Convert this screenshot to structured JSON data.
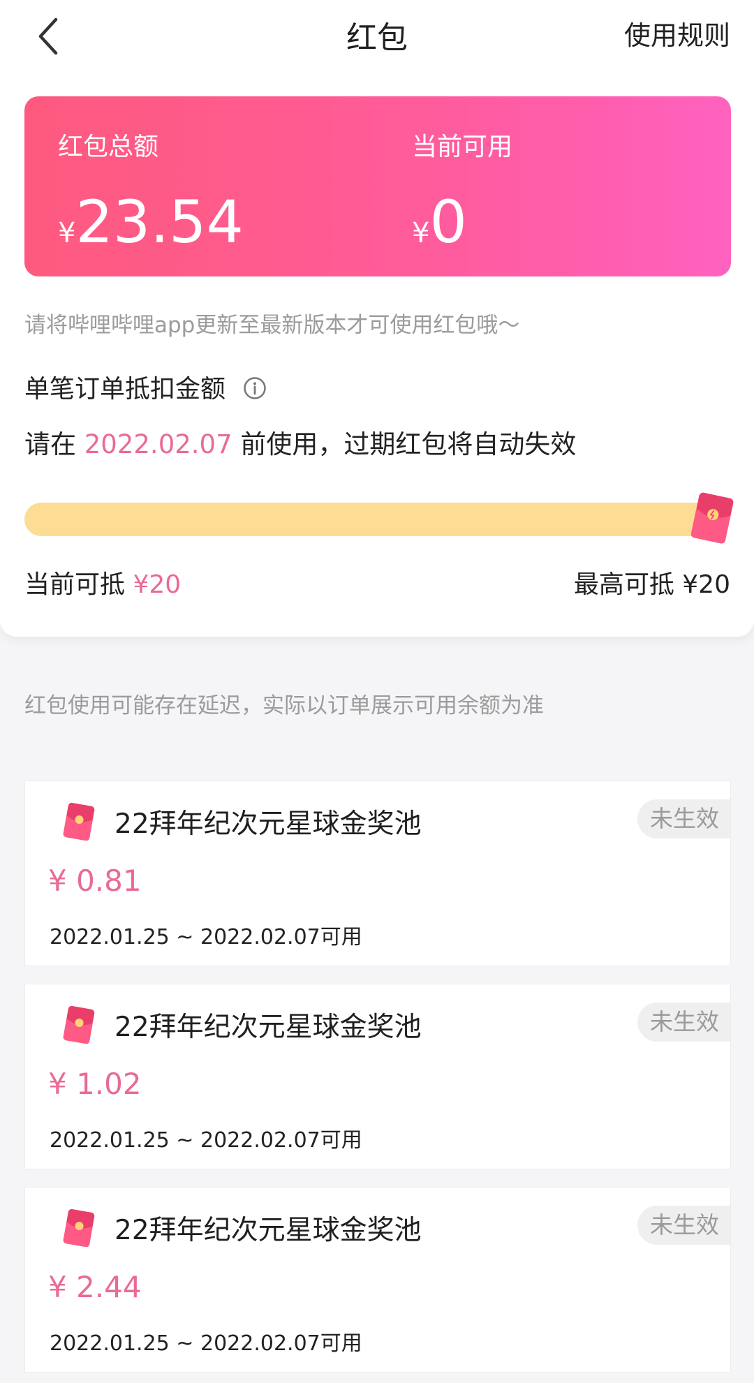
{
  "nav": {
    "title": "红包",
    "rules_label": "使用规则"
  },
  "summary": {
    "total_label": "红包总额",
    "total_currency": "¥",
    "total_value": "23.54",
    "available_label": "当前可用",
    "available_currency": "¥",
    "available_value": "0"
  },
  "notice": "请将哔哩哔哩app更新至最新版本才可使用红包哦～",
  "deduction": {
    "title": "单笔订单抵扣金额",
    "expire_prefix": "请在",
    "expire_date": "2022.02.07",
    "expire_suffix": "前使用，过期红包将自动失效",
    "progress_fraction": 1.0,
    "current_label": "当前可抵",
    "current_value": "¥20",
    "max_label": "最高可抵 ¥20"
  },
  "delay_notice": "红包使用可能存在延迟，实际以订单展示可用余额为准",
  "packets": [
    {
      "name": "22拜年纪次元星球金奖池",
      "status": "未生效",
      "amount": "¥ 0.81",
      "validity": "2022.01.25 ~ 2022.02.07可用"
    },
    {
      "name": "22拜年纪次元星球金奖池",
      "status": "未生效",
      "amount": "¥ 1.02",
      "validity": "2022.01.25 ~ 2022.02.07可用"
    },
    {
      "name": "22拜年纪次元星球金奖池",
      "status": "未生效",
      "amount": "¥ 2.44",
      "validity": "2022.01.25 ~ 2022.02.07可用"
    }
  ],
  "colors": {
    "accent": "#e96b93",
    "card_start": "#fe5a7f",
    "card_end": "#ff62c0",
    "progress": "#fddc94"
  },
  "icons": {
    "back": "chevron-left-icon",
    "info": "info-circle-icon",
    "envelope": "red-envelope-icon"
  }
}
